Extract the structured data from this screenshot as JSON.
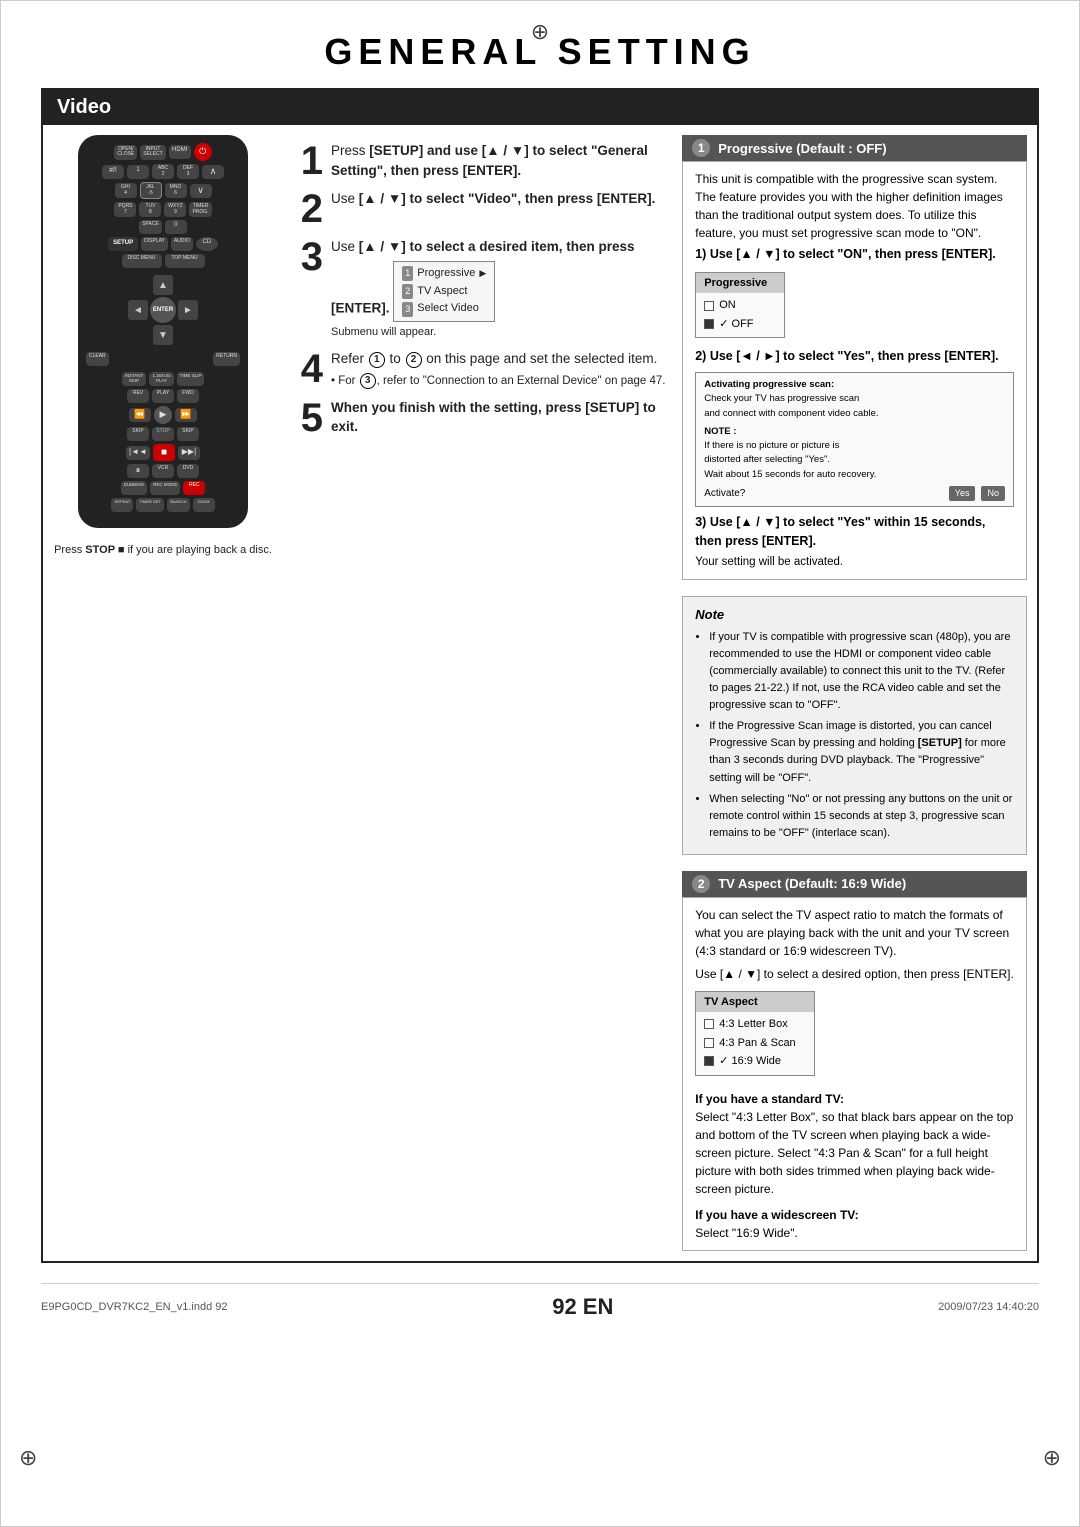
{
  "page": {
    "title": "GENERAL SETTING",
    "section": "Video",
    "footer_left": "E9PG0CD_DVR7KC2_EN_v1.indd  92",
    "footer_right": "2009/07/23  14:40:20",
    "page_num": "92 EN"
  },
  "press_stop": "Press STOP ■ if you are playing back a disc.",
  "steps": [
    {
      "num": "1",
      "text": "Press [SETUP] and use [▲ / ▼] to select \"General Setting\", then press [ENTER]."
    },
    {
      "num": "2",
      "text": "Use [▲ / ▼] to select \"Video\", then press [ENTER]."
    },
    {
      "num": "3",
      "text": "Use [▲ / ▼] to select a desired item, then press [ENTER]."
    },
    {
      "num": "4",
      "text": "Refer ① to ② on this page and set the selected item.",
      "sub": "• For ③ , refer to \"Connection to an External Device\" on page 47."
    },
    {
      "num": "5",
      "text": "When you finish with the setting, press [SETUP] to exit."
    }
  ],
  "submenu": {
    "items": [
      {
        "num": "1",
        "label": "Progressive"
      },
      {
        "num": "2",
        "label": "TV Aspect"
      },
      {
        "num": "3",
        "label": "Select Video"
      }
    ],
    "sub_text": "Submenu will appear."
  },
  "panel1": {
    "num": "1",
    "header": "Progressive (Default : OFF)",
    "body": "This unit is compatible with the progressive scan system. The feature provides you with the higher definition images than the traditional output system does. To utilize this feature, you must set progressive scan mode to \"ON\".",
    "step1": "1) Use [▲ / ▼] to select \"ON\", then press [ENTER].",
    "prog_title": "Progressive",
    "prog_options": [
      "ON",
      "OFF"
    ],
    "prog_checked": 1,
    "step2": "2) Use [◄ / ►] to select \"Yes\", then press [ENTER].",
    "activate_text": "Activating progressive scan:\nCheck your TV has progressive scan\nand connect with component video cable.",
    "note_label": "NOTE :",
    "note_text": "If there is no picture or picture is\ndistorted after selecting \"Yes\".\nWait about 15 seconds for auto recovery.",
    "activate_label": "Activate?",
    "yes_label": "Yes",
    "no_label": "No",
    "step3": "3) Use [▲ / ▼] to select \"Yes\" within 15 seconds, then press [ENTER].",
    "step3_sub": "Your setting will be activated."
  },
  "note": {
    "title": "Note",
    "items": [
      "If your TV is compatible with progressive scan (480p), you are recommended to use the HDMI or component video cable (commercially available) to connect this unit to the TV. (Refer to pages 21-22.) If not, use the RCA video cable and set the progressive scan to \"OFF\".",
      "If the Progressive Scan image is distorted, you can cancel Progressive Scan by pressing and holding [SETUP] for more than 3 seconds during DVD playback. The \"Progressive\" setting will be \"OFF\".",
      "When selecting \"No\" or not pressing any buttons on the unit or remote control within 15 seconds at step 3, progressive scan remains to be \"OFF\" (interlace scan)."
    ]
  },
  "panel2": {
    "num": "2",
    "header": "TV Aspect (Default: 16:9 Wide)",
    "body": "You can select the TV aspect ratio to match the formats of what you are playing back with the unit and your TV screen (4:3 standard or 16:9 widescreen TV).",
    "select_text": "Use [▲ / ▼] to select a desired option, then press [ENTER].",
    "ta_title": "TV Aspect",
    "ta_options": [
      "4:3 Letter Box",
      "4:3 Pan & Scan",
      "16:9 Wide"
    ],
    "ta_checked": 2,
    "standard_tv_title": "If you have a standard TV:",
    "standard_tv_text": "Select \"4:3 Letter Box\", so that black bars appear on the top and bottom of the TV screen when playing back a wide-screen picture. Select \"4:3 Pan & Scan\" for a full height picture with both sides trimmed when playing back wide-screen picture.",
    "widescreen_tv_title": "If you have a widescreen TV:",
    "widescreen_tv_text": "Select \"16:9 Wide\"."
  },
  "remote": {
    "label": "remote control"
  }
}
